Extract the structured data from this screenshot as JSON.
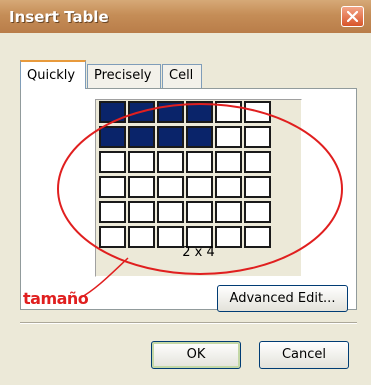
{
  "dialog": {
    "title": "Insert Table",
    "close_icon": "close-icon"
  },
  "tabs": [
    {
      "label": "Quickly",
      "active": true
    },
    {
      "label": "Precisely",
      "active": false
    },
    {
      "label": "Cell",
      "active": false
    }
  ],
  "grid": {
    "rows": 6,
    "columns": 6,
    "selected_rows": 2,
    "selected_columns": 4,
    "size_label": "2 x 4",
    "selected_color": "#0a246a"
  },
  "annotation": {
    "label": "tamaño",
    "color": "#e01f1f"
  },
  "buttons": {
    "advanced_edit": "Advanced Edit...",
    "ok": "OK",
    "cancel": "Cancel"
  }
}
